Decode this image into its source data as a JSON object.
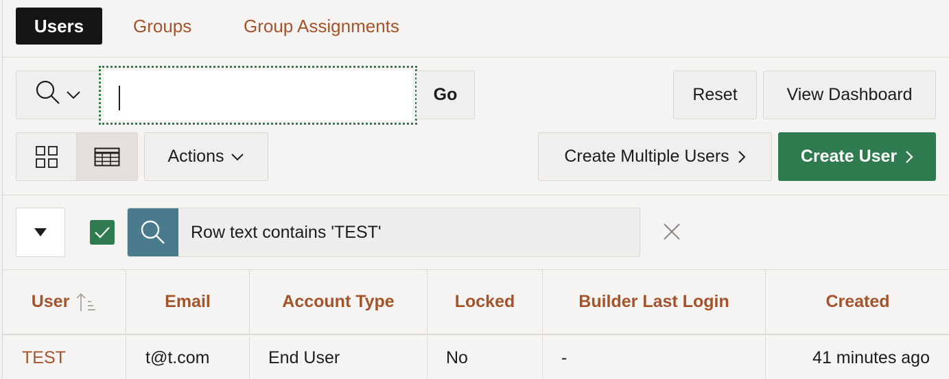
{
  "tabs": [
    {
      "label": "Users",
      "active": true
    },
    {
      "label": "Groups",
      "active": false
    },
    {
      "label": "Group Assignments",
      "active": false
    }
  ],
  "toolbar": {
    "search_value": "",
    "go_label": "Go",
    "reset_label": "Reset",
    "view_dashboard_label": "View Dashboard",
    "actions_label": "Actions",
    "create_multiple_label": "Create Multiple Users",
    "create_user_label": "Create User"
  },
  "filter": {
    "text": "Row text contains 'TEST'",
    "enabled": true
  },
  "table": {
    "columns": [
      "User",
      "Email",
      "Account Type",
      "Locked",
      "Builder Last Login",
      "Created"
    ],
    "sort_column": "User",
    "sort_direction": "ascending",
    "rows": [
      {
        "user": "TEST",
        "email": "t@t.com",
        "account_type": "End User",
        "locked": "No",
        "builder_last_login": "-",
        "created": "41 minutes ago"
      }
    ]
  },
  "colors": {
    "accent": "#a4532b",
    "primary_button": "#2f7b4f",
    "active_tab": "#161513",
    "filter_icon_bg": "#4a7b8c"
  }
}
